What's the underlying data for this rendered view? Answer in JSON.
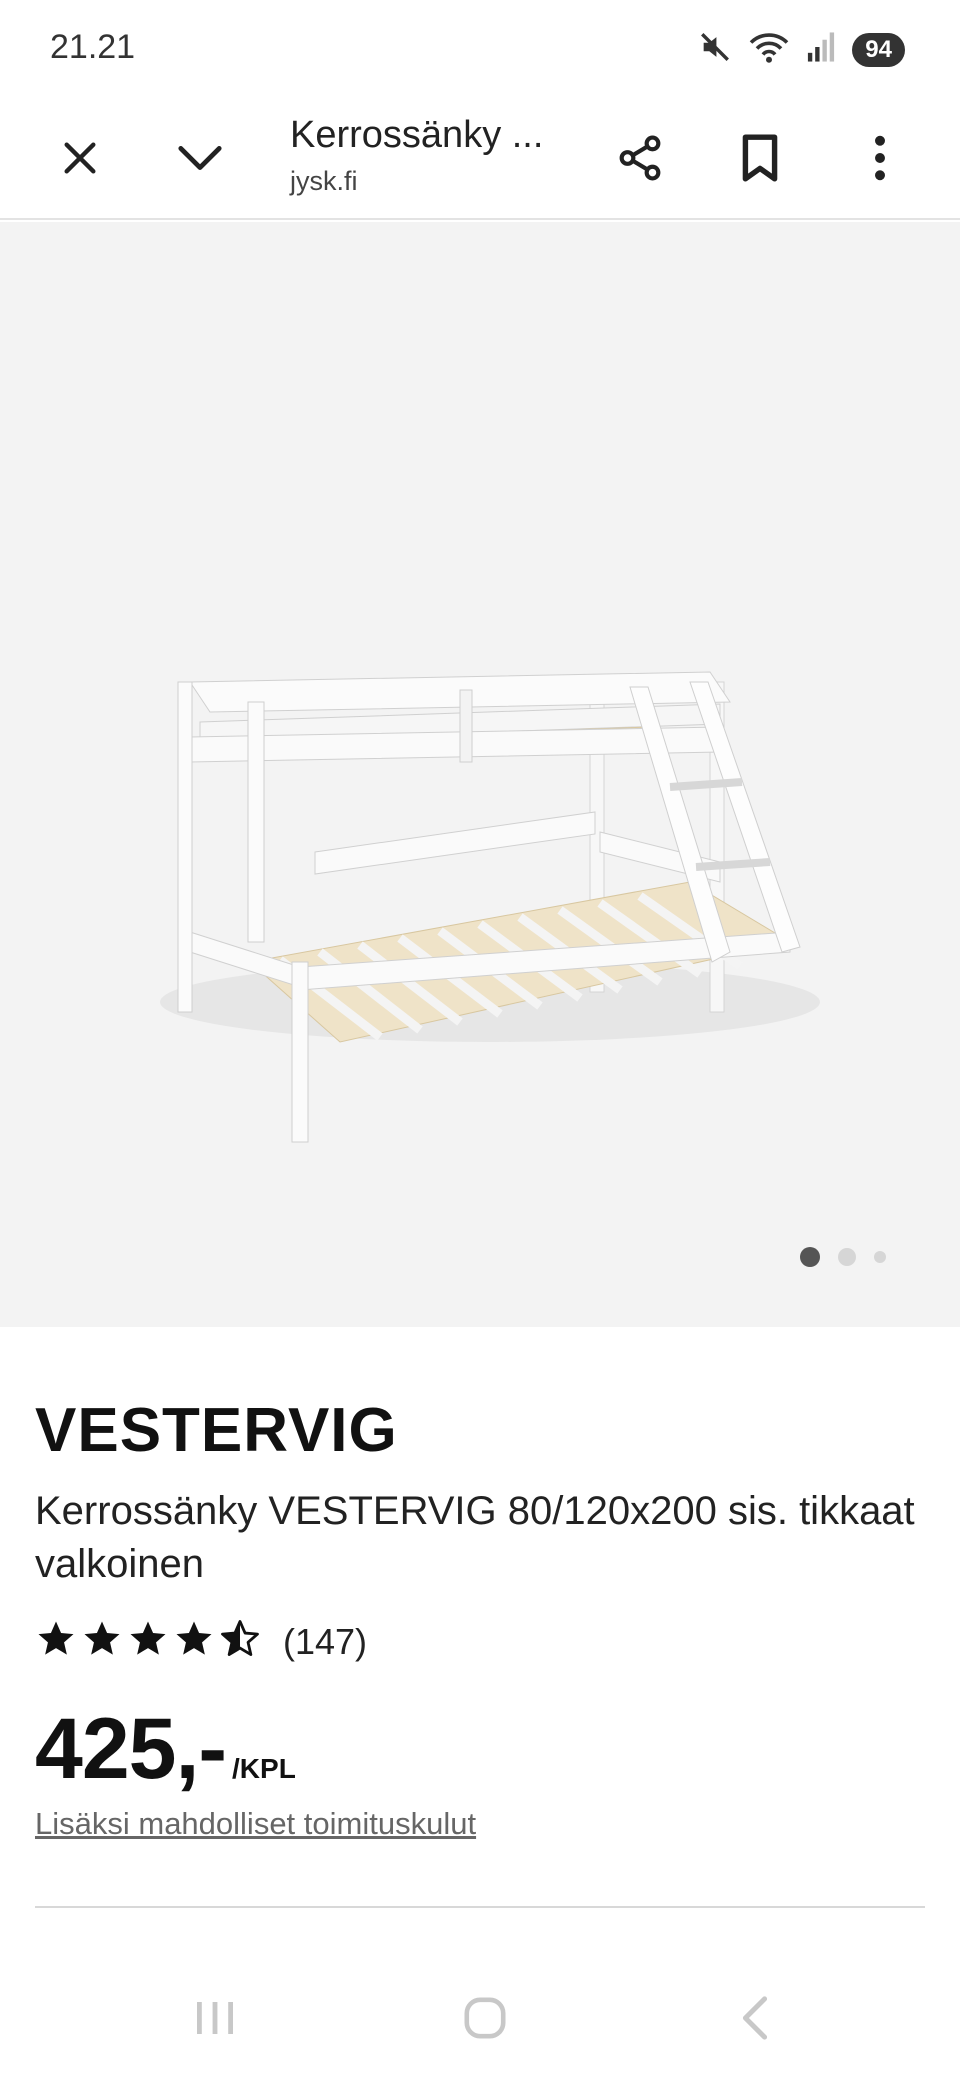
{
  "status_bar": {
    "time": "21.21",
    "battery": "94",
    "icons": [
      "mute-icon",
      "wifi-icon",
      "signal-icon",
      "battery-icon"
    ]
  },
  "toolbar": {
    "title": "Kerrossänky ...",
    "domain": "jysk.fi",
    "icons": [
      "close-icon",
      "chevron-down-icon",
      "share-icon",
      "bookmark-icon",
      "more-vert-icon"
    ]
  },
  "gallery": {
    "image_count": 3,
    "active_index": 0,
    "background": "#f3f3f3"
  },
  "product": {
    "brand": "VESTERVIG",
    "description": "Kerrossänky VESTERVIG 80/120x200 sis. tikkaat valkoinen",
    "rating": 4.5,
    "rating_max": 5,
    "review_count": "(147)",
    "price": "425,-",
    "price_unit": "/KPL",
    "delivery_note": "Lisäksi mahdolliset toimituskulut"
  },
  "nav_bar": {
    "icons": [
      "recent-apps-icon",
      "home-icon",
      "back-icon"
    ]
  }
}
